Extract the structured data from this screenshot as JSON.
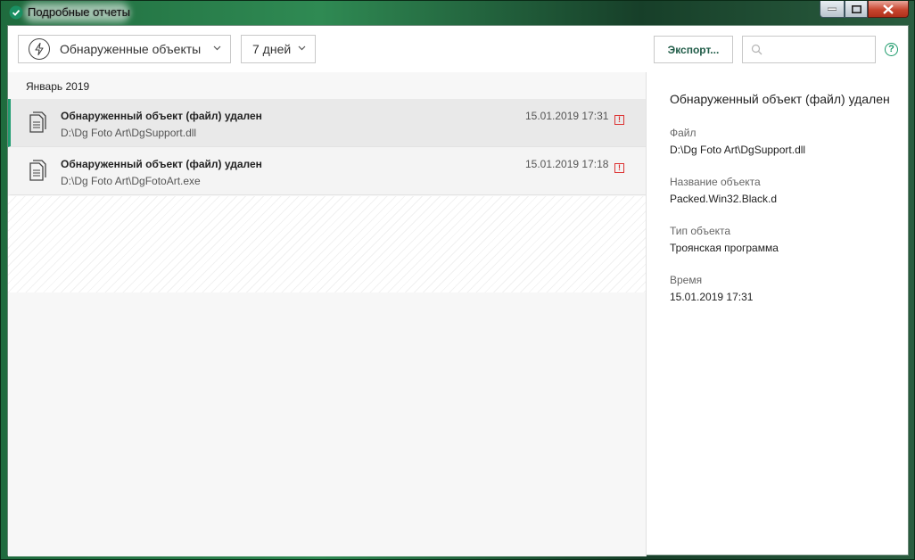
{
  "window": {
    "title": "Подробные отчеты",
    "controls": [
      "minimize",
      "maximize",
      "close"
    ]
  },
  "toolbar": {
    "category_dropdown": {
      "label": "Обнаруженные объекты",
      "icon": "lightning-icon"
    },
    "period_dropdown": {
      "label": "7 дней"
    },
    "export_label": "Экспорт...",
    "search": {
      "value": "",
      "placeholder": ""
    },
    "help_label": "?"
  },
  "list": {
    "group_header": "Январь 2019",
    "items": [
      {
        "title": "Обнаруженный объект (файл) удален",
        "path": "D:\\Dg Foto Art\\DgSupport.dll",
        "datetime": "15.01.2019 17:31",
        "status_badge": "!"
      },
      {
        "title": "Обнаруженный объект (файл) удален",
        "path": "D:\\Dg Foto Art\\DgFotoArt.exe",
        "datetime": "15.01.2019 17:18",
        "status_badge": "!"
      }
    ]
  },
  "details": {
    "title": "Обнаруженный объект (файл) удален",
    "fields": [
      {
        "label": "Файл",
        "value": "D:\\Dg Foto Art\\DgSupport.dll"
      },
      {
        "label": "Название объекта",
        "value": "Packed.Win32.Black.d"
      },
      {
        "label": "Тип объекта",
        "value": "Троянская программа"
      },
      {
        "label": "Время",
        "value": "15.01.2019 17:31"
      }
    ]
  },
  "colors": {
    "accent": "#1f9c70",
    "warning": "#dd3333",
    "export_text": "#1f5b47"
  }
}
